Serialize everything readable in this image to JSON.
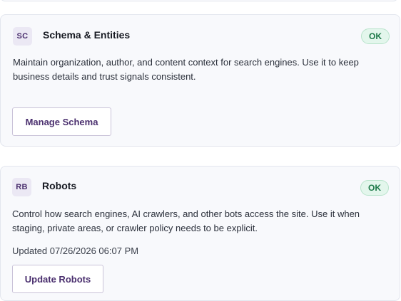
{
  "cards": [
    {
      "badge": "SC",
      "title": "Schema & Entities",
      "status": "OK",
      "description_line1": "Maintain organization, author, and content context for search engines. Use it to keep",
      "description_line2": "business details and trust signals consistent.",
      "button_label": "Manage Schema"
    },
    {
      "badge": "RB",
      "title": "Robots",
      "status": "OK",
      "description_line1": "Control how search engines, AI crawlers, and other bots access the site. Use it when",
      "description_line2": "staging, private areas, or crawler policy needs to be explicit.",
      "updated": "Updated 07/26/2026 06:07 PM",
      "button_label": "Update Robots"
    }
  ],
  "colors": {
    "accent": "#4a2f6e",
    "status_ok_bg": "#e3f6ec",
    "status_ok_text": "#1e7a4a",
    "card_bg": "#f8f9fc",
    "card_border": "#e3e6ee"
  }
}
